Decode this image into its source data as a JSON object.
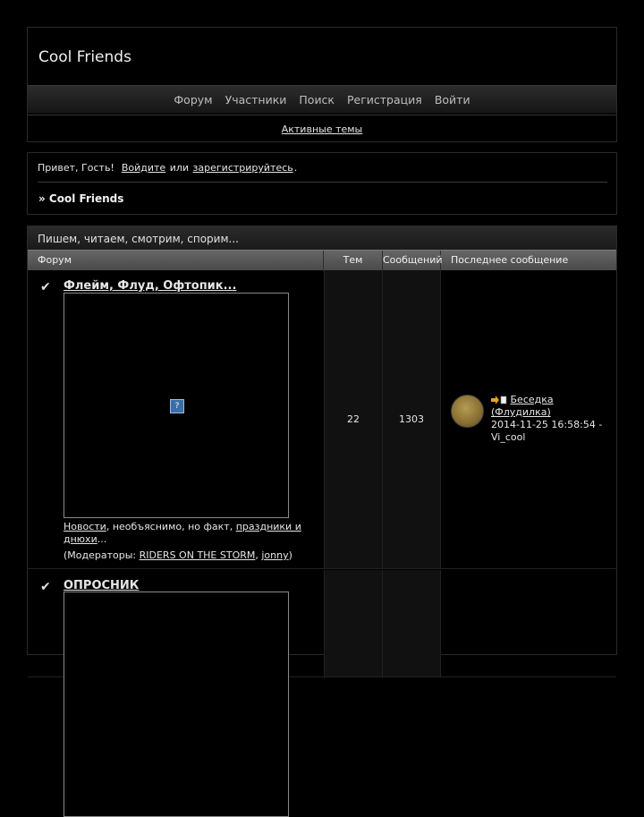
{
  "site": {
    "title": "Cool Friends"
  },
  "nav": {
    "items": [
      "Форум",
      "Участники",
      "Поиск",
      "Регистрация",
      "Войти"
    ],
    "sub_link": "Активные темы"
  },
  "welcome": {
    "greeting": "Привет, Гость!",
    "login_link": "Войдите",
    "or_text": "или",
    "register_link": "зарегистрируйтесь",
    "period": ".",
    "breadcrumb": "» Cool Friends"
  },
  "category": {
    "title": "Пишем, читаем, смотрим, спорим...",
    "columns": {
      "forum": "Форум",
      "topics": "Тем",
      "posts": "Сообщений",
      "last": "Последнее сообщение"
    },
    "forums": [
      {
        "name": "Флейм, Флуд, Офтопик...",
        "image_icon": "broken-image-icon",
        "desc_link1": "Новости",
        "desc_text": ", необъяснимо, но факт, ",
        "desc_link2": "праздники и днюхи",
        "desc_tail": "...",
        "mods_prefix": "(Модераторы: ",
        "mod1": "RIDERS ON THE STORM",
        "mods_sep": ", ",
        "mod2": "jonny",
        "mods_suffix": ")",
        "topics": "22",
        "posts": "1303",
        "last_topic": "Беседка (Флудилка)",
        "last_meta": "2014-11-25 16:58:54 - Vi_cool"
      },
      {
        "name": "ОПРОСНИК"
      }
    ]
  }
}
